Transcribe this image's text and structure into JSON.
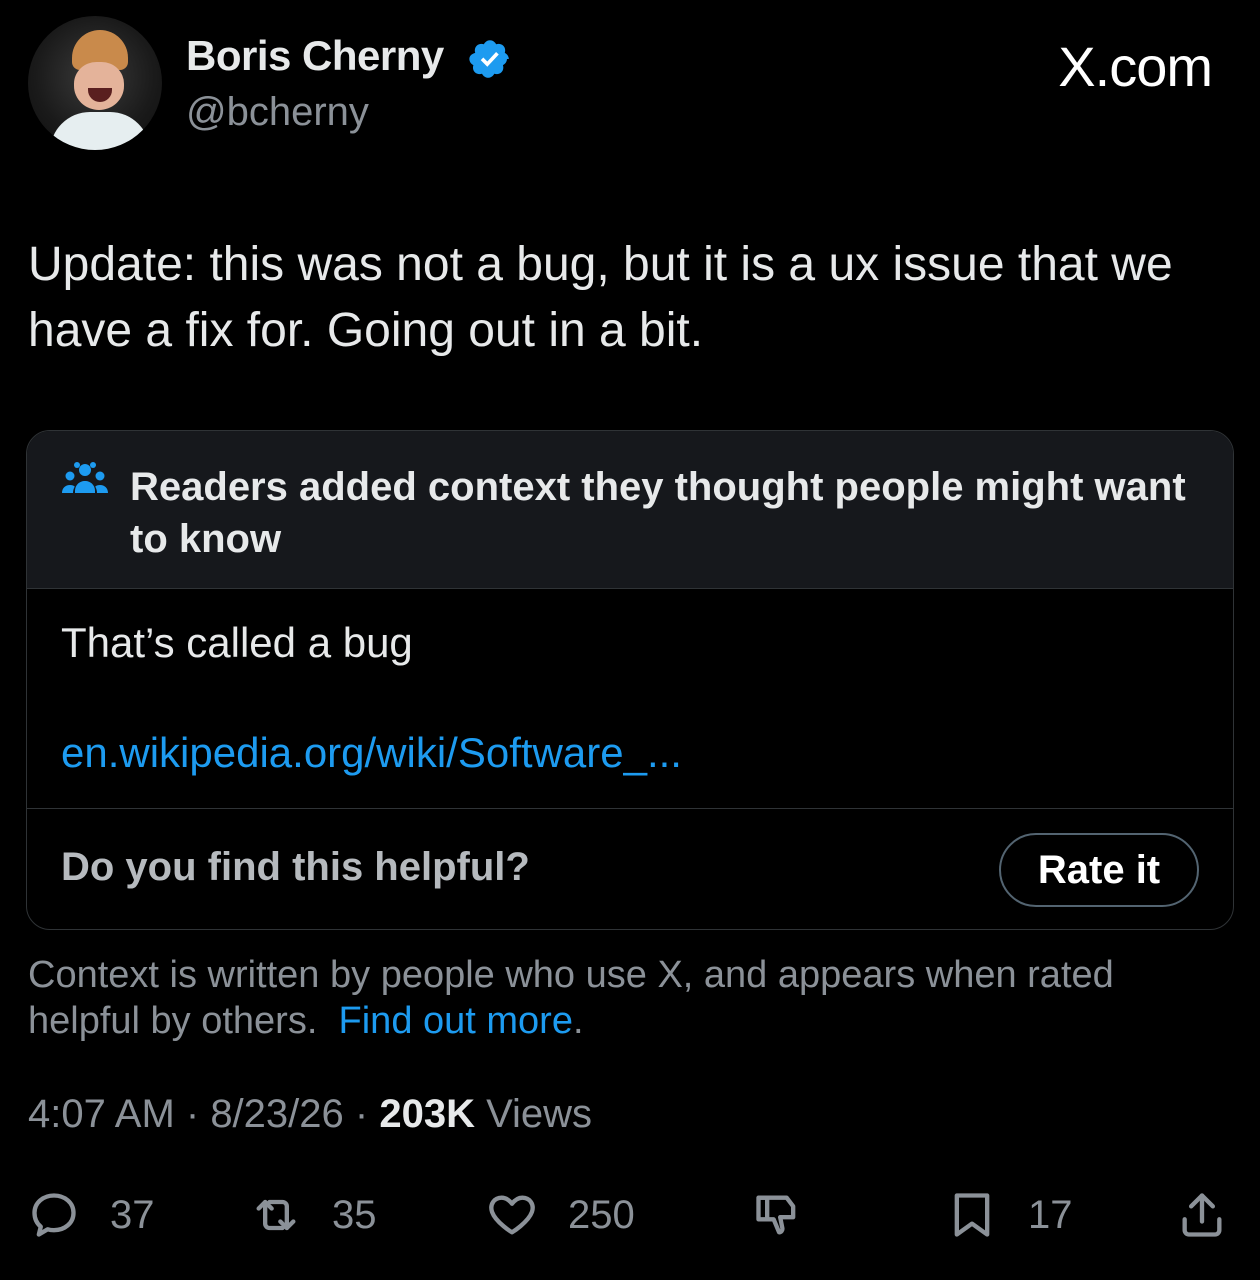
{
  "author": {
    "name": "Boris Cherny",
    "handle": "@bcherny",
    "verified_color": "#1d9bf0"
  },
  "brand": "X.com",
  "tweet": {
    "text": "Update: this was not a bug, but it is a ux issue that we have a fix for. Going out in a bit."
  },
  "community_note": {
    "icon": "people-icon",
    "title": "Readers added context they thought people might want to know",
    "text": "That’s called a bug",
    "link": "en.wikipedia.org/wiki/Software_...",
    "helpful_question": "Do you find this helpful?",
    "rate_button": "Rate it"
  },
  "context_info": {
    "text": "Context is written by people who use X, and appears when rated helpful by others.",
    "link": "Find out more",
    "link_suffix": "."
  },
  "meta": {
    "time": "4:07 AM",
    "separator": " · ",
    "date": "8/23/26",
    "views_count": "203K",
    "views_label": " Views"
  },
  "actions": {
    "replies": "37",
    "reposts": "35",
    "likes": "250",
    "bookmarks": "17"
  },
  "colors": {
    "background": "#000000",
    "text": "#e7e9ea",
    "muted": "#8b9198",
    "link": "#1d9bf0"
  }
}
